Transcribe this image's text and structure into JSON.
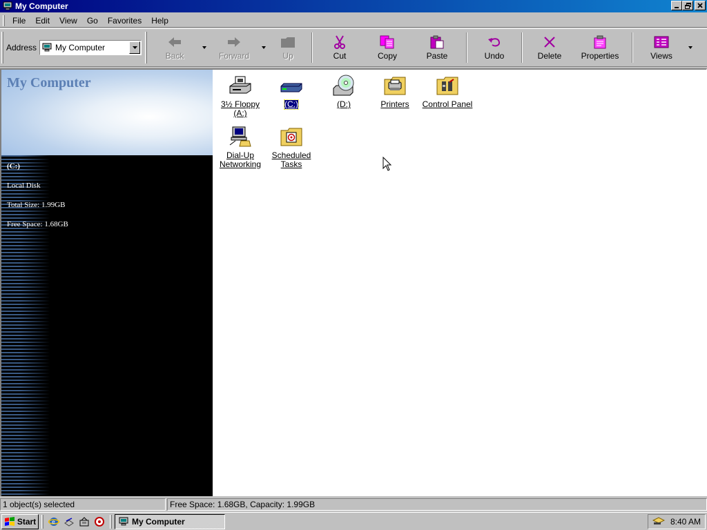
{
  "window": {
    "title": "My Computer",
    "title_icon": "computer-icon",
    "buttons": {
      "minimize": "_",
      "maximize": "□",
      "close": "×"
    }
  },
  "menu": {
    "items": [
      {
        "label": "File"
      },
      {
        "label": "Edit"
      },
      {
        "label": "View"
      },
      {
        "label": "Go"
      },
      {
        "label": "Favorites"
      },
      {
        "label": "Help"
      }
    ]
  },
  "address": {
    "label": "Address",
    "value": "My Computer"
  },
  "toolbar": {
    "back": "Back",
    "forward": "Forward",
    "up": "Up",
    "cut": "Cut",
    "copy": "Copy",
    "paste": "Paste",
    "undo": "Undo",
    "delete": "Delete",
    "properties": "Properties",
    "views": "Views"
  },
  "left_pane": {
    "title": "My Computer",
    "drive_name": "(C:)",
    "drive_type": "Local Disk",
    "total_size": "Total Size: 1.99GB",
    "free_space": "Free Space: 1.68GB"
  },
  "icons": [
    {
      "label": "3½ Floppy (A:)",
      "icon": "floppy-drive-icon",
      "selected": false
    },
    {
      "label": "(C:)",
      "icon": "hard-drive-icon",
      "selected": true
    },
    {
      "label": "(D:)",
      "icon": "cd-drive-icon",
      "selected": false
    },
    {
      "label": "Printers",
      "icon": "printers-folder-icon",
      "selected": false
    },
    {
      "label": "Control Panel",
      "icon": "control-panel-folder-icon",
      "selected": false
    },
    {
      "label": "Dial-Up Networking",
      "icon": "dial-up-networking-icon",
      "selected": false
    },
    {
      "label": "Scheduled Tasks",
      "icon": "scheduled-tasks-folder-icon",
      "selected": false
    }
  ],
  "status": {
    "selection": "1 object(s) selected",
    "space": "Free Space: 1.68GB,  Capacity: 1.99GB"
  },
  "taskbar": {
    "start": "Start",
    "task": "My Computer",
    "time": "8:40 AM"
  },
  "colors": {
    "title_gradient_start": "#000080",
    "title_gradient_end": "#1084d0",
    "face": "#c0c0c0",
    "selection": "#000080",
    "cut_icon": "#a000a0",
    "banner_title": "#5b7fb4"
  }
}
